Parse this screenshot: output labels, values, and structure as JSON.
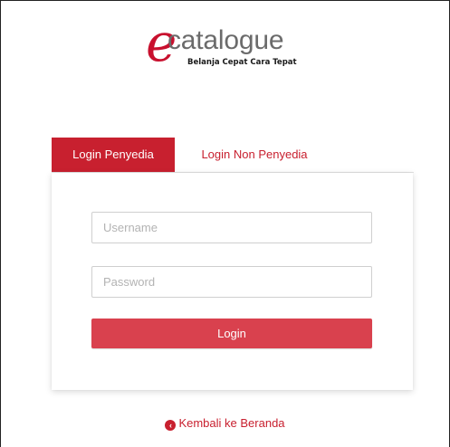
{
  "logo": {
    "letter": "e",
    "word": "catalogue",
    "tagline": "Belanja Cepat Cara Tepat"
  },
  "tabs": [
    {
      "label": "Login Penyedia",
      "active": true
    },
    {
      "label": "Login Non Penyedia",
      "active": false
    }
  ],
  "form": {
    "username_placeholder": "Username",
    "password_placeholder": "Password",
    "login_label": "Login"
  },
  "back_link": {
    "icon": "chevron-left-circle-icon",
    "label": "Kembali ke Beranda"
  },
  "colors": {
    "brand": "#c8202f",
    "button": "#d9414e"
  }
}
